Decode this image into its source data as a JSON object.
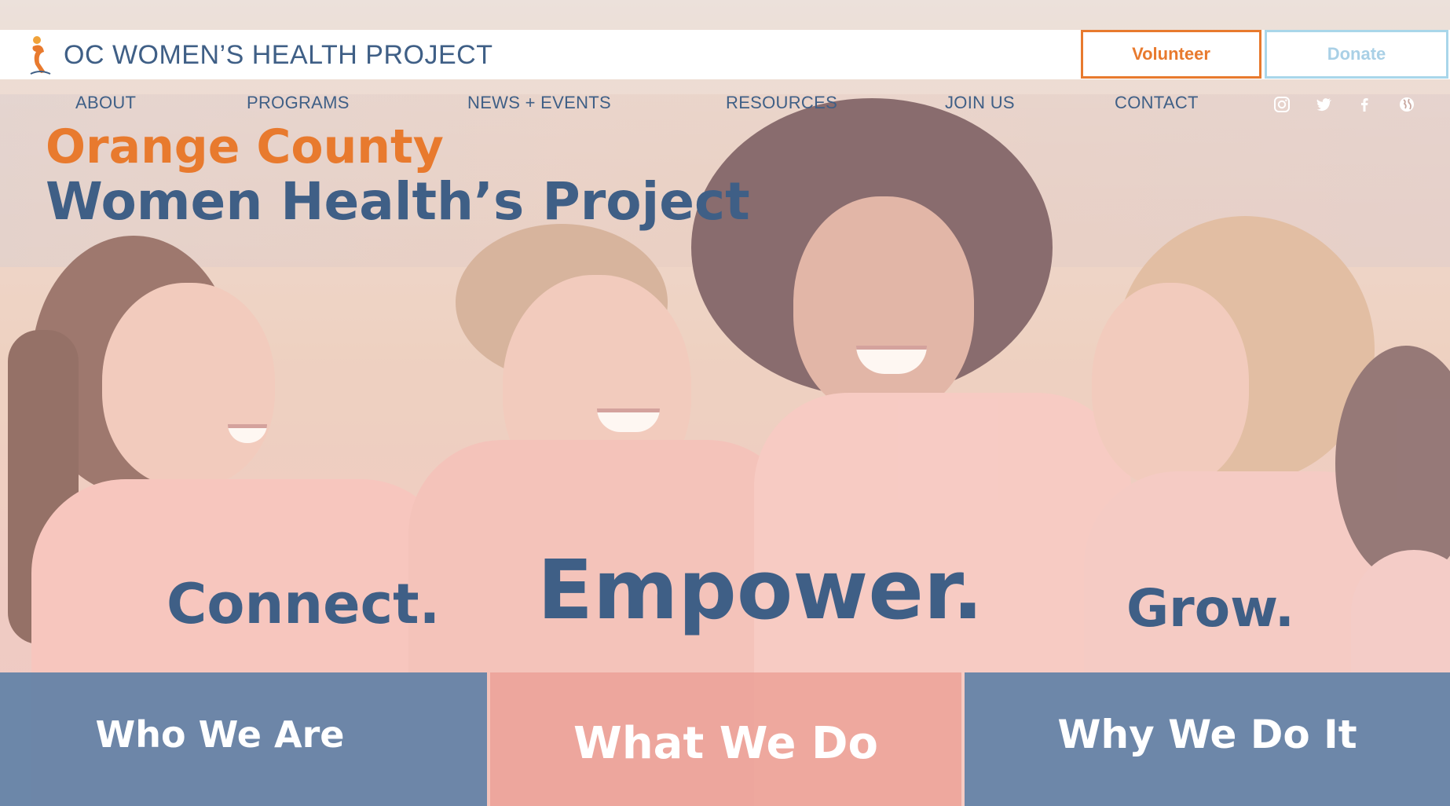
{
  "header": {
    "site_title": "OC WOMEN’S HEALTH PROJECT",
    "volunteer_label": "Volunteer",
    "donate_label": "Donate"
  },
  "nav": {
    "items": [
      "ABOUT",
      "PROGRAMS",
      "NEWS + EVENTS",
      "RESOURCES",
      "JOIN US",
      "CONTACT"
    ],
    "social_icons": [
      "instagram-icon",
      "twitter-icon",
      "facebook-icon",
      "globe-icon"
    ]
  },
  "hero": {
    "headline_line1": "Orange County",
    "headline_line2": "Women Health’s Project",
    "taglines": [
      "Connect.",
      "Empower.",
      "Grow."
    ]
  },
  "panels": [
    {
      "label": "Who We Are"
    },
    {
      "label": "What We Do"
    },
    {
      "label": "Why We Do It"
    }
  ],
  "colors": {
    "brand_orange": "#e87a2e",
    "brand_blue": "#3f5f86",
    "donate_light_blue": "#a9d6ea",
    "panel_blue": "#5a7da5",
    "panel_pink": "#eca096"
  }
}
